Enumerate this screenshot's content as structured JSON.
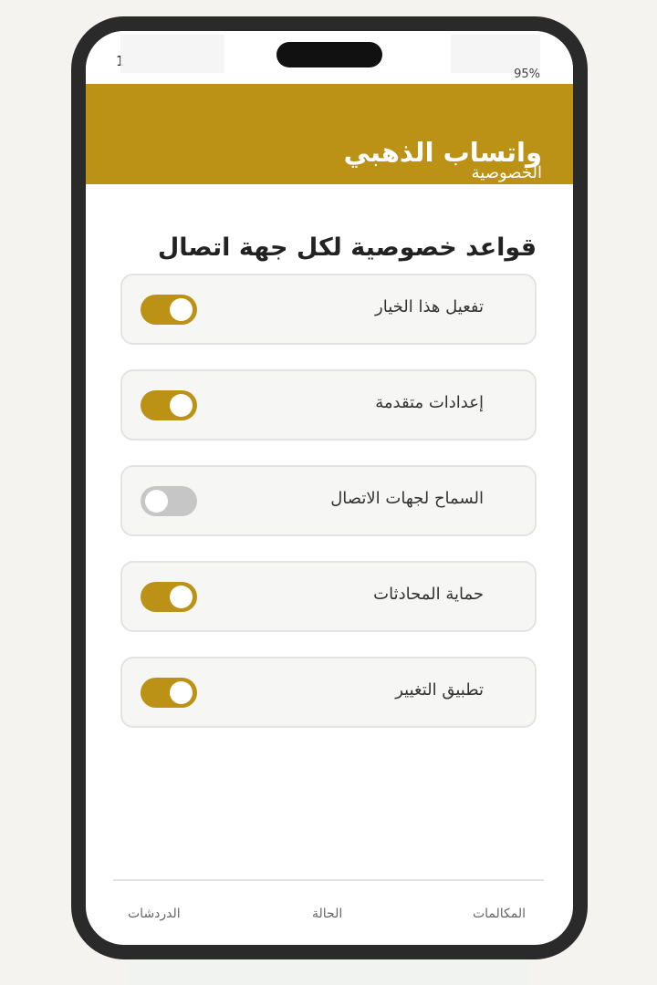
{
  "status_bar": {
    "time": "1",
    "battery": "95%"
  },
  "header": {
    "title": "واتساب الذهبي",
    "subtitle": "الخصوصية"
  },
  "section": {
    "title": "قواعد خصوصية لكل جهة اتصال"
  },
  "settings": [
    {
      "label": "تفعيل هذا الخيار",
      "enabled": true
    },
    {
      "label": "إعدادات متقدمة",
      "enabled": true
    },
    {
      "label": "السماح لجهات الاتصال",
      "enabled": false
    },
    {
      "label": "حماية المحادثات",
      "enabled": true
    },
    {
      "label": "تطبيق التغيير",
      "enabled": true
    }
  ],
  "nav": {
    "calls": "المكالمات",
    "status": "الحالة",
    "chats": "الدردشات"
  },
  "colors": {
    "accent": "#bb9116",
    "toggle_off": "#c6c6c6",
    "frame": "#2a2a2a"
  }
}
